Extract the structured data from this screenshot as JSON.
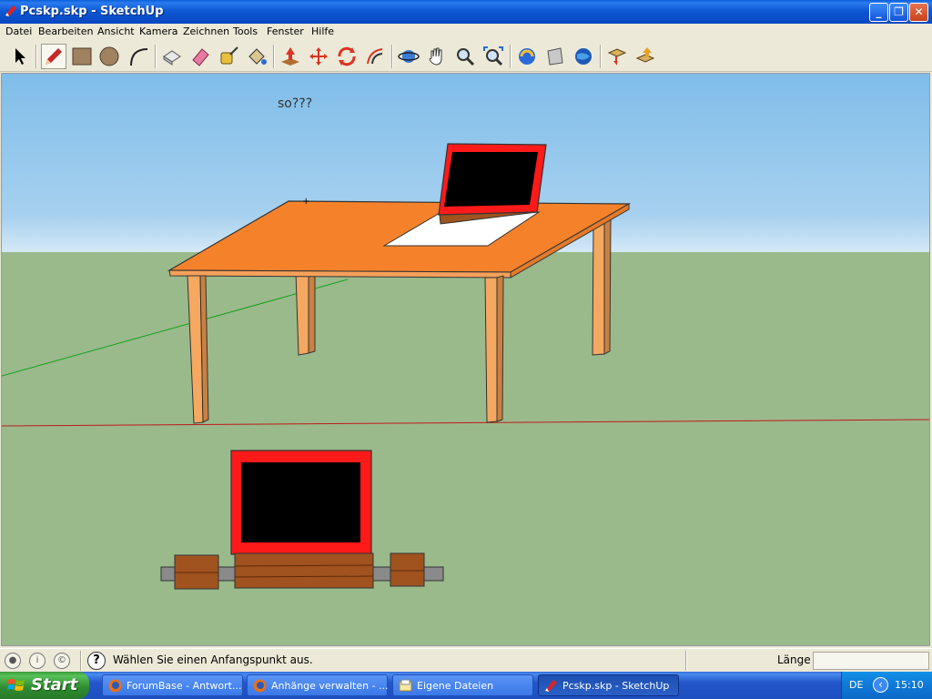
{
  "window": {
    "title": "Pcskp.skp - SketchUp",
    "controls": {
      "minimize": "_",
      "maximize": "❐",
      "close": "✕"
    }
  },
  "menu": [
    "Datei",
    "Bearbeiten",
    "Ansicht",
    "Kamera",
    "Zeichnen",
    "Tools",
    "Fenster",
    "Hilfe"
  ],
  "toolbar": {
    "tools": [
      {
        "name": "select-icon"
      },
      {
        "name": "pencil-icon"
      },
      {
        "name": "rectangle-icon"
      },
      {
        "name": "circle-icon"
      },
      {
        "name": "arc-icon"
      },
      {
        "name": "make-component-icon"
      },
      {
        "name": "eraser-icon"
      },
      {
        "name": "tape-measure-icon"
      },
      {
        "name": "paint-bucket-icon"
      },
      {
        "name": "push-pull-icon"
      },
      {
        "name": "move-icon"
      },
      {
        "name": "rotate-icon"
      },
      {
        "name": "offset-icon"
      },
      {
        "name": "orbit-icon"
      },
      {
        "name": "pan-icon"
      },
      {
        "name": "zoom-icon"
      },
      {
        "name": "zoom-extents-icon"
      },
      {
        "name": "3d-warehouse-icon"
      },
      {
        "name": "share-model-icon"
      },
      {
        "name": "google-earth-icon"
      },
      {
        "name": "get-models-icon"
      },
      {
        "name": "share-component-icon"
      }
    ]
  },
  "viewport": {
    "annotation": "so???",
    "colors": {
      "sky": "#a7d1ef",
      "ground": "#9aba8c",
      "table": "#f5822a",
      "screen_frame": "#ff1a1a",
      "screen": "#000000",
      "wood": "#a0531e"
    }
  },
  "status": {
    "message": "Wählen Sie einen Anfangspunkt aus.",
    "vcb_label": "Länge",
    "vcb_value": ""
  },
  "taskbar": {
    "start": "Start",
    "tasks": [
      {
        "label": "ForumBase - Antwort...",
        "icon": "firefox-icon",
        "active": false
      },
      {
        "label": "Anhänge verwalten - ...",
        "icon": "firefox-icon",
        "active": false
      },
      {
        "label": "Eigene Dateien",
        "icon": "folder-icon",
        "active": false
      },
      {
        "label": "Pcskp.skp - SketchUp",
        "icon": "sketchup-icon",
        "active": true
      }
    ],
    "tray": {
      "language": "DE",
      "time": "15:10"
    }
  }
}
